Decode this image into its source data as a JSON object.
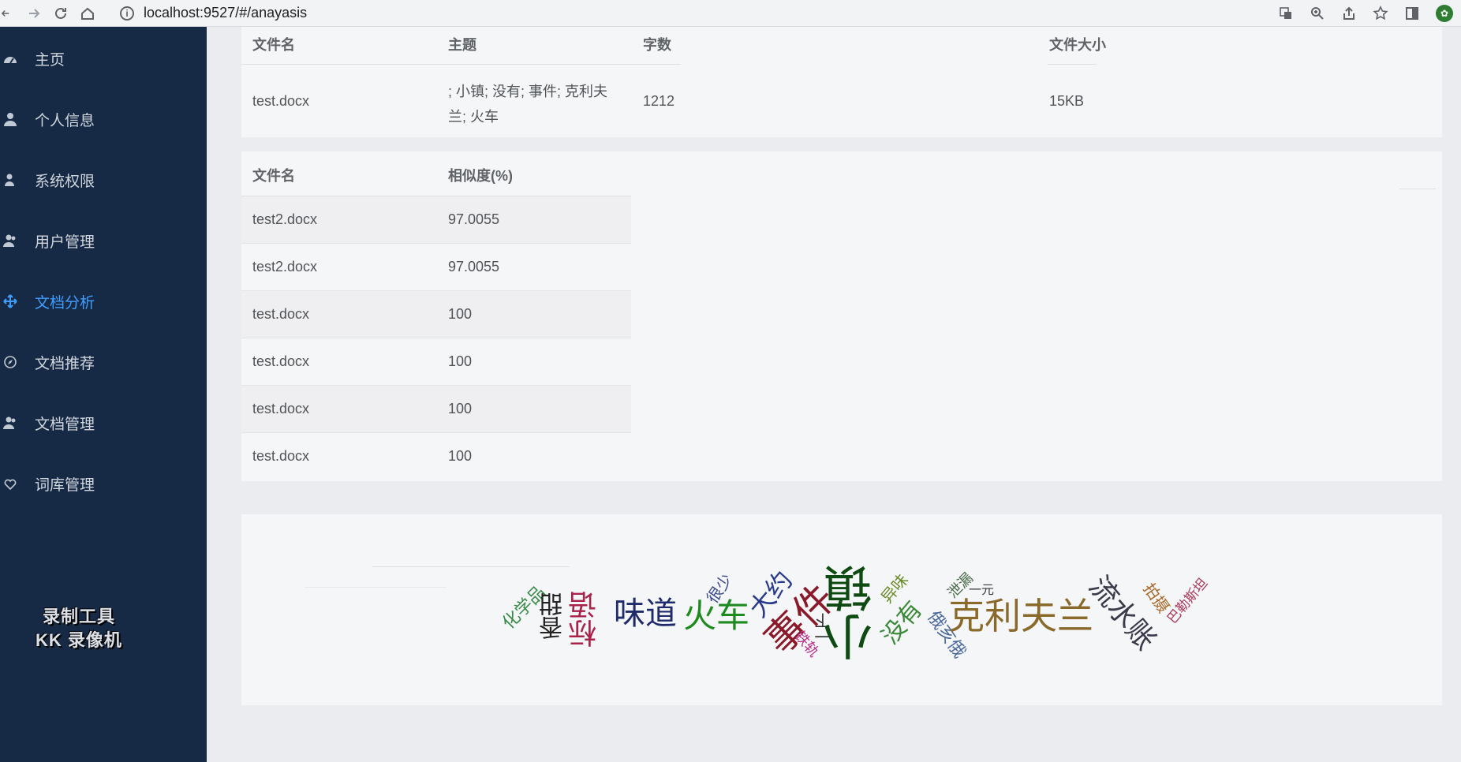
{
  "browser": {
    "url": "localhost:9527/#/anayasis"
  },
  "sidebar": {
    "items": [
      {
        "label": "主页",
        "icon": "dashboard-icon",
        "active": false
      },
      {
        "label": "个人信息",
        "icon": "user-icon",
        "active": false
      },
      {
        "label": "系统权限",
        "icon": "user-key-icon",
        "active": false
      },
      {
        "label": "用户管理",
        "icon": "users-icon",
        "active": false
      },
      {
        "label": "文档分析",
        "icon": "move-cross-icon",
        "active": true
      },
      {
        "label": "文档推荐",
        "icon": "compass-icon",
        "active": false
      },
      {
        "label": "文档管理",
        "icon": "users-icon",
        "active": false
      },
      {
        "label": "词库管理",
        "icon": "heart-shield-icon",
        "active": false
      }
    ],
    "watermark": [
      "录制工具",
      "KK 录像机"
    ],
    "active_color": "#409eff",
    "background": "#172a45"
  },
  "doc_info": {
    "headers": {
      "filename": "文件名",
      "topic": "主题",
      "word_count": "字数",
      "file_size": "文件大小"
    },
    "row": {
      "filename": "test.docx",
      "topic_line1": "; 小镇; 没有; 事件; 克利夫",
      "topic_line2": "兰; 火车",
      "word_count": "1212",
      "file_size": "15KB"
    }
  },
  "similarity": {
    "headers": {
      "filename": "文件名",
      "similarity": "相似度(%)"
    },
    "rows": [
      {
        "filename": "test2.docx",
        "similarity": "97.0055"
      },
      {
        "filename": "test2.docx",
        "similarity": "97.0055"
      },
      {
        "filename": "test.docx",
        "similarity": "100"
      },
      {
        "filename": "test.docx",
        "similarity": "100"
      },
      {
        "filename": "test.docx",
        "similarity": "100"
      },
      {
        "filename": "test.docx",
        "similarity": "100"
      }
    ]
  },
  "word_cloud": {
    "words": [
      {
        "text": "化学品",
        "color": "#3a8a4a"
      },
      {
        "text": "香甜",
        "color": "#222222"
      },
      {
        "text": "标语",
        "color": "#a8234a"
      },
      {
        "text": "味道",
        "color": "#1f2a6b"
      },
      {
        "text": "火车",
        "color": "#1f8a1f"
      },
      {
        "text": "很少",
        "color": "#3c4a8a"
      },
      {
        "text": "大约",
        "color": "#2a3a8a"
      },
      {
        "text": "事件",
        "color": "#8a1a2a"
      },
      {
        "text": "一下",
        "color": "#2a2a2a"
      },
      {
        "text": "铁轨",
        "color": "#b8308a"
      },
      {
        "text": "小镇",
        "color": "#0f4a12"
      },
      {
        "text": "异味",
        "color": "#6a8a2a"
      },
      {
        "text": "没有",
        "color": "#3a8a3a"
      },
      {
        "text": "俄亥俄",
        "color": "#4a6a9a"
      },
      {
        "text": "泄漏",
        "color": "#4a6a4a"
      },
      {
        "text": "一元",
        "color": "#3a3a3a"
      },
      {
        "text": "克利夫兰",
        "color": "#8a6a2a"
      },
      {
        "text": "流水账",
        "color": "#3a3a4a"
      },
      {
        "text": "拍摄",
        "color": "#a86a2a"
      },
      {
        "text": "巴勒斯坦",
        "color": "#a83a5a"
      }
    ]
  }
}
